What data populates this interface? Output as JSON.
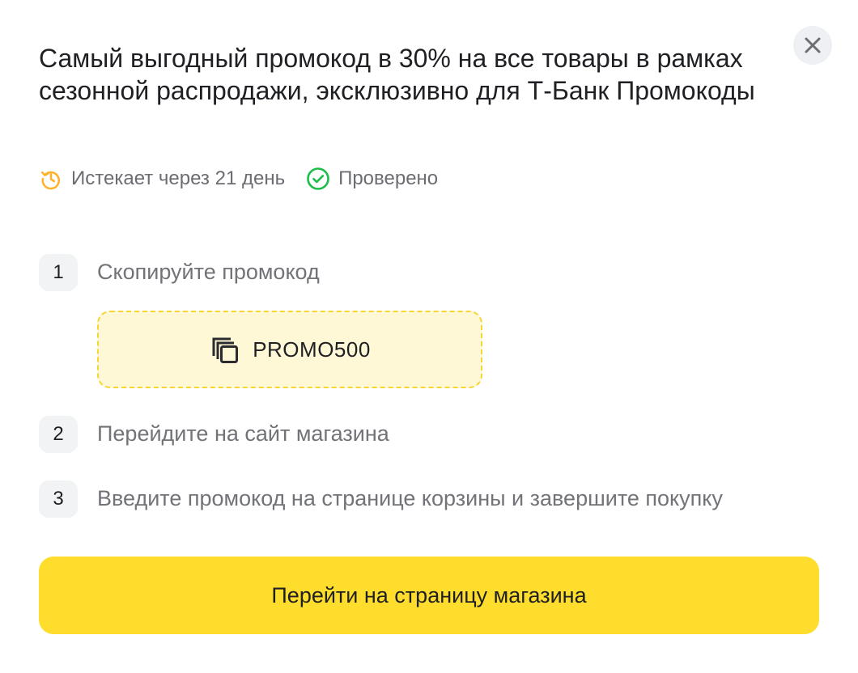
{
  "modal": {
    "title": "Самый выгодный промокод в 30% на все товары в рамках сезонной распродажи, эксклюзивно для Т-Банк Промокоды",
    "close_icon": "close-icon"
  },
  "meta": {
    "expires": {
      "icon": "clock-history-icon",
      "text": "Истекает через 21 день",
      "color": "#ffb22e"
    },
    "verified": {
      "icon": "check-circle-icon",
      "text": "Проверено",
      "color": "#1cbe49"
    }
  },
  "steps": [
    {
      "number": "1",
      "text": "Скопируйте промокод"
    },
    {
      "number": "2",
      "text": "Перейдите на сайт магазина"
    },
    {
      "number": "3",
      "text": "Введите промокод на странице корзины и завершите покупку"
    }
  ],
  "promo": {
    "icon": "copy-icon",
    "code": "PROMO500"
  },
  "cta": {
    "label": "Перейти на страницу магазина",
    "color": "#ffdd2d"
  }
}
